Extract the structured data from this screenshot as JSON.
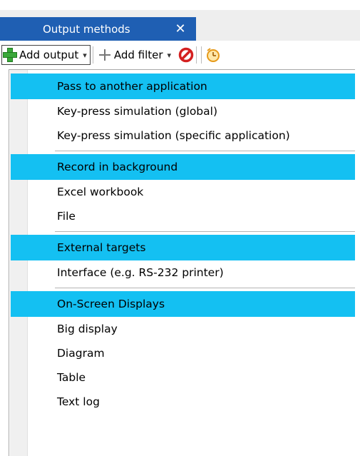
{
  "tab": {
    "title": "Output methods",
    "close_glyph": "✕"
  },
  "toolbar": {
    "add_output_label": "Add output",
    "add_output_icon": "add-green-plus-icon",
    "add_filter_label": "Add filter",
    "add_filter_icon": "filter-cross-icon",
    "caret_glyph": "▾",
    "remove_icon": "prohibited-red-icon",
    "schedule_icon": "clock-icon"
  },
  "menu": {
    "groups": [
      {
        "header": "Pass to another application",
        "items": [
          "Key-press simulation (global)",
          "Key-press simulation (specific application)"
        ]
      },
      {
        "header": "Record in background",
        "items": [
          "Excel workbook",
          "File"
        ]
      },
      {
        "header": "External targets",
        "items": [
          "Interface (e.g. RS-232 printer)"
        ]
      },
      {
        "header": "On-Screen Displays",
        "items": [
          "Big display",
          "Diagram",
          "Table",
          "Text log"
        ]
      }
    ]
  },
  "colors": {
    "tab_bg": "#1f5fb3",
    "header_highlight": "#14c0f2",
    "menu_gutter": "#f0f0f0"
  }
}
